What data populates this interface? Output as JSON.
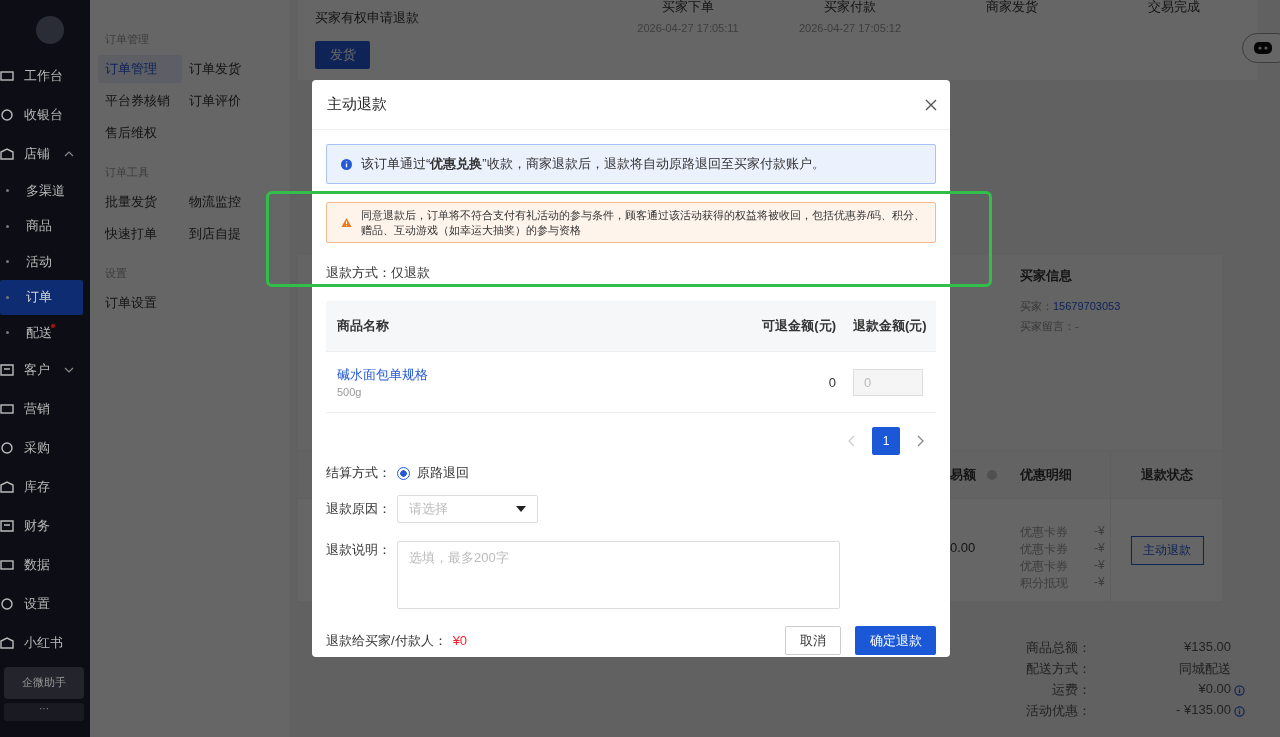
{
  "sidebar": {
    "items": [
      {
        "label": "工作台",
        "kind": "main",
        "selected": false
      },
      {
        "label": "收银台",
        "kind": "main",
        "selected": false
      },
      {
        "label": "店铺",
        "kind": "main",
        "selected": false,
        "expanded": true
      },
      {
        "label": "多渠道",
        "kind": "sub",
        "selected": false
      },
      {
        "label": "商品",
        "kind": "sub",
        "selected": false
      },
      {
        "label": "活动",
        "kind": "sub",
        "selected": false
      },
      {
        "label": "订单",
        "kind": "sub",
        "selected": true
      },
      {
        "label": "配送",
        "kind": "sub",
        "selected": false,
        "notice": true
      },
      {
        "label": "客户",
        "kind": "main",
        "selected": false,
        "expanded": false
      },
      {
        "label": "营销",
        "kind": "main",
        "selected": false
      },
      {
        "label": "采购",
        "kind": "main",
        "selected": false
      },
      {
        "label": "库存",
        "kind": "main",
        "selected": false
      },
      {
        "label": "财务",
        "kind": "main",
        "selected": false
      },
      {
        "label": "数据",
        "kind": "main",
        "selected": false
      },
      {
        "label": "设置",
        "kind": "main",
        "selected": false
      },
      {
        "label": "小红书",
        "kind": "main",
        "selected": false
      }
    ],
    "assistant": "企微助手",
    "more": "···"
  },
  "submenu": {
    "groups": [
      {
        "title": "订单管理",
        "items": [
          {
            "label": "订单管理",
            "selected": true
          },
          {
            "label": "订单发货",
            "selected": false
          },
          {
            "label": "平台券核销",
            "selected": false
          },
          {
            "label": "订单评价",
            "selected": false
          },
          {
            "label": "售后维权",
            "selected": false
          }
        ]
      },
      {
        "title": "订单工具",
        "items": [
          {
            "label": "批量发货",
            "selected": false
          },
          {
            "label": "物流监控",
            "selected": false
          },
          {
            "label": "快速打单",
            "selected": false
          },
          {
            "label": "到店自提",
            "selected": false
          }
        ]
      },
      {
        "title": "设置",
        "items": [
          {
            "label": "订单设置",
            "selected": false
          }
        ]
      }
    ]
  },
  "order": {
    "notice": "买家有权申请退款",
    "ship_button": "发货",
    "steps": [
      {
        "title": "买家下单",
        "time": "2026-04-27 17:05:11"
      },
      {
        "title": "买家付款",
        "time": "2026-04-27 17:05:12"
      },
      {
        "title": "商家发货"
      },
      {
        "title": "交易完成"
      }
    ],
    "buyer_info": {
      "title": "买家信息",
      "buyer_label": "买家：",
      "buyer": "15679703053",
      "message": "买家留言：-"
    },
    "table": {
      "columns": [
        "易额",
        "优惠明细",
        "退款状态"
      ],
      "amount": "0.00",
      "discounts": [
        {
          "name": "优惠卡券",
          "amount": "-¥"
        },
        {
          "name": "优惠卡券",
          "amount": "-¥"
        },
        {
          "name": "优惠卡券",
          "amount": "-¥"
        },
        {
          "name": "积分抵现",
          "amount": "-¥"
        }
      ],
      "refund_button": "主动退款"
    },
    "totals": [
      {
        "label": "商品总额：",
        "value": "¥135.00",
        "info": false
      },
      {
        "label": "配送方式：",
        "value": "同城配送",
        "info": false
      },
      {
        "label": "运费：",
        "value": "¥0.00",
        "info": true
      },
      {
        "label": "活动优惠：",
        "value": "- ¥135.00",
        "info": true
      }
    ]
  },
  "dialog": {
    "title": "主动退款",
    "info": "该订单通过“**优惠兑换**”收款，商家退款后，退款将自动原路退回至买家付款账户。",
    "warning": "同意退款后，订单将不符合支付有礼活动的参与条件，顾客通过该活动获得的权益将被收回，包括优惠券/码、积分、赠品、互动游戏（如幸运大抽奖）的参与资格",
    "refund_method": "退款方式：仅退款",
    "table": {
      "columns": [
        "商品名称",
        "可退金额(元)",
        "退款金额(元)"
      ],
      "rows": [
        {
          "name": "碱水面包单规格",
          "spec": "500g",
          "refundable": "0",
          "refund": "0",
          "disabled": true
        }
      ]
    },
    "pagination": {
      "pages": [
        {
          "label": "1",
          "selected": true
        }
      ],
      "prev_disabled": true,
      "next_disabled": false
    },
    "settlement": {
      "label": "结算方式：",
      "options": [
        {
          "label": "原路退回",
          "selected": true
        }
      ]
    },
    "reason": {
      "label": "退款原因：",
      "placeholder": "请选择"
    },
    "note": {
      "label": "退款说明：",
      "placeholder": "选填，最多200字"
    },
    "total_label": "退款给买家/付款人：",
    "total": "¥0",
    "buttons": [
      {
        "label": "取消",
        "kind": "secondary"
      },
      {
        "label": "确定退款",
        "kind": "primary"
      }
    ]
  }
}
